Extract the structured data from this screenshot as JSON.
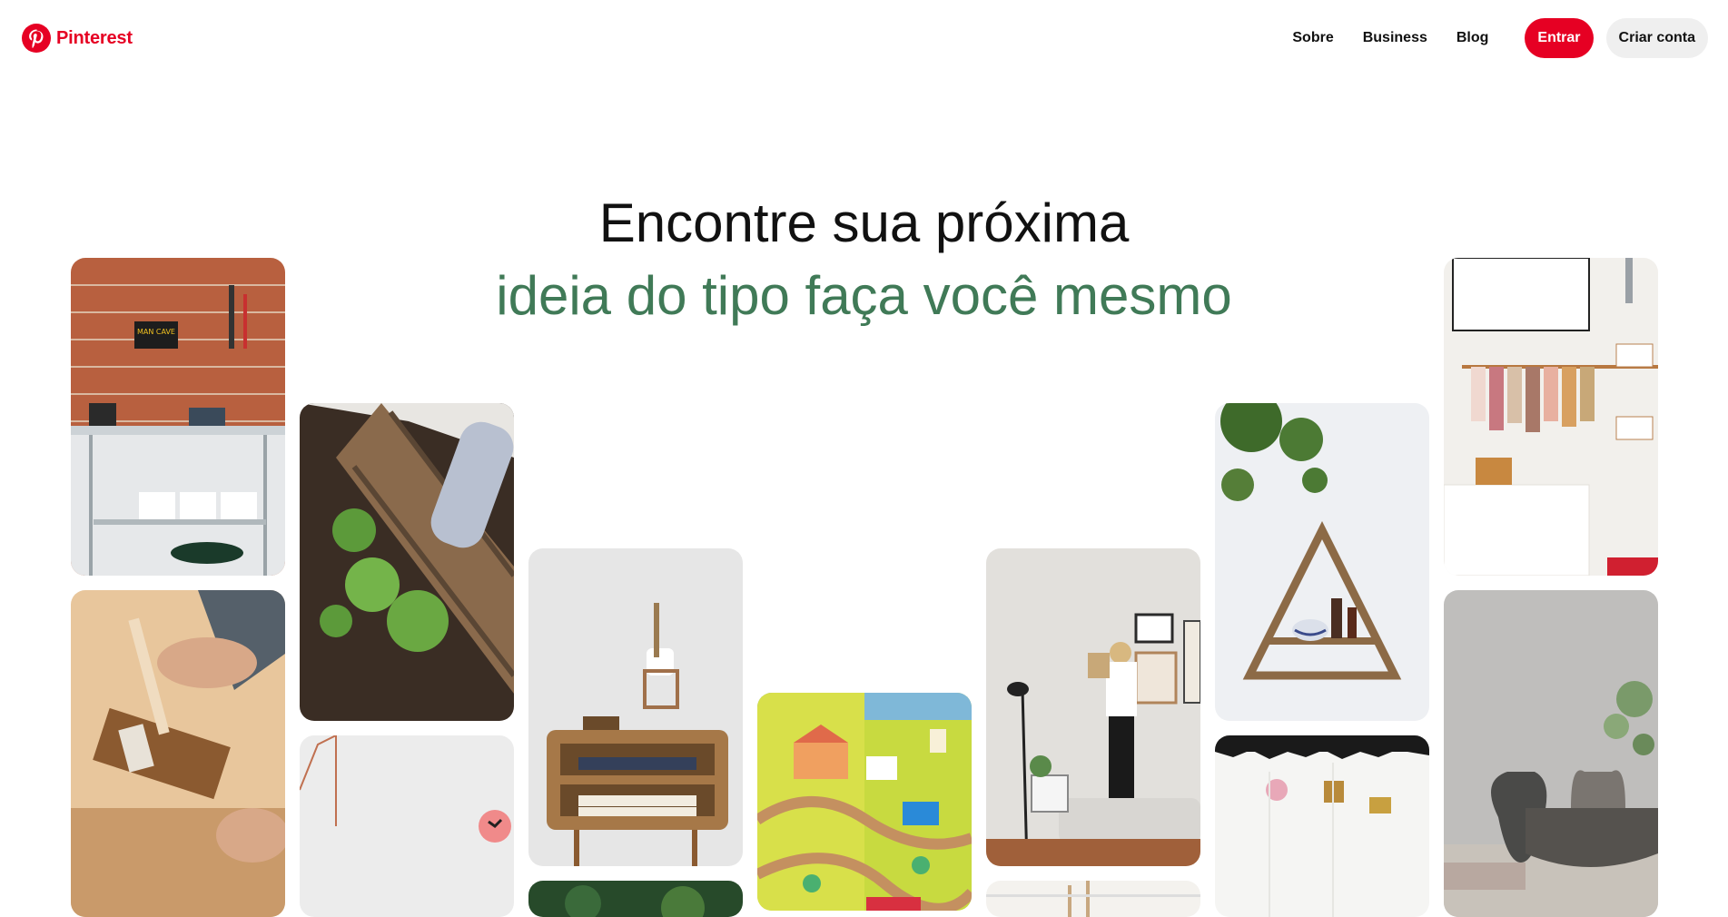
{
  "header": {
    "brand": "Pinterest",
    "nav": {
      "about": "Sobre",
      "business": "Business",
      "blog": "Blog"
    },
    "login_label": "Entrar",
    "signup_label": "Criar conta"
  },
  "hero": {
    "line1": "Encontre sua próxima",
    "line2": "ideia do tipo faça você mesmo"
  },
  "colors": {
    "brand": "#e60023",
    "accent_green": "#407a57"
  },
  "pins": [
    {
      "name": "garage-tool-wall-pin",
      "label": "MAN CAVE"
    },
    {
      "name": "painting-wood-frame-pin"
    },
    {
      "name": "planter-box-seedlings-pin"
    },
    {
      "name": "hanging-clock-pin"
    },
    {
      "name": "wooden-nightstand-pin"
    },
    {
      "name": "green-foliage-pin"
    },
    {
      "name": "toy-railway-board-pin"
    },
    {
      "name": "woman-hanging-frames-pin"
    },
    {
      "name": "white-shelf-pin"
    },
    {
      "name": "triangle-wall-shelf-pin"
    },
    {
      "name": "pressed-flowers-paper-pin"
    },
    {
      "name": "clothing-rack-pin"
    },
    {
      "name": "ceramic-vases-pin"
    }
  ]
}
